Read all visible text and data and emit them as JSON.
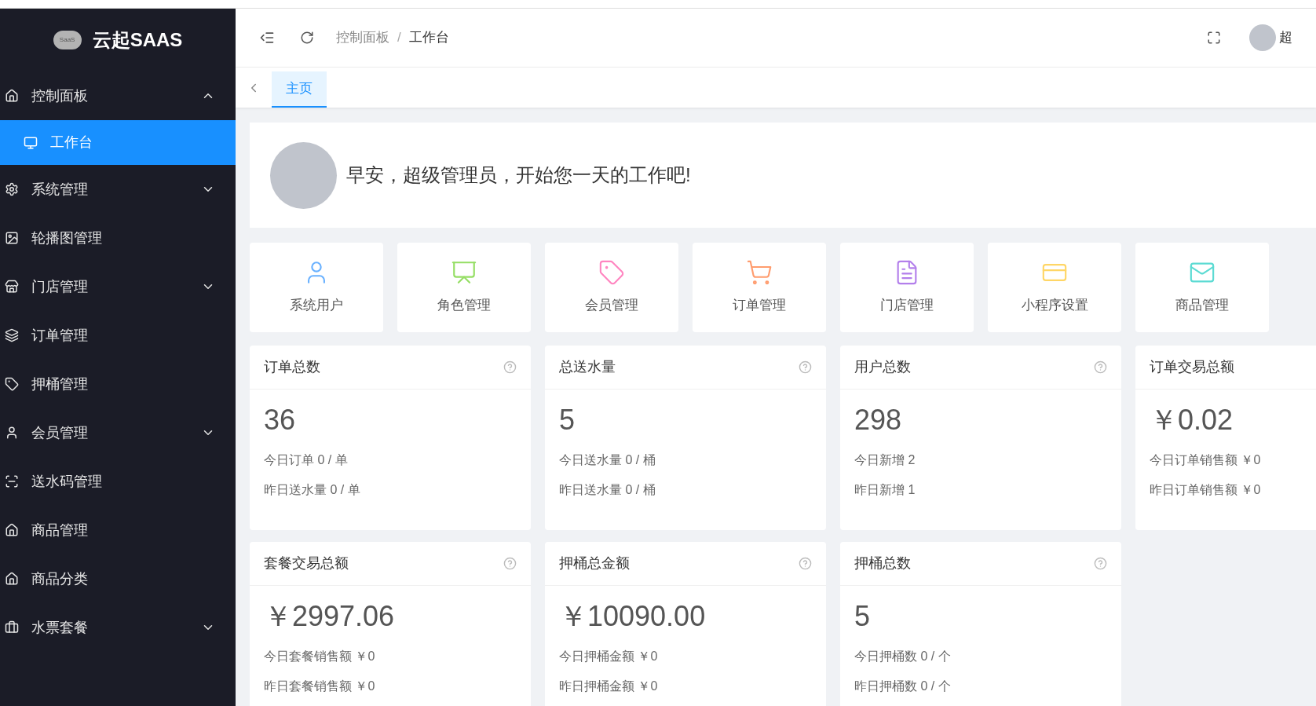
{
  "brand": {
    "logo_text": "SaaS",
    "name": "云起SAAS"
  },
  "sidebar": {
    "items": [
      {
        "label": "控制面板",
        "expanded": true,
        "has_children": true,
        "children": [
          {
            "label": "工作台",
            "selected": true
          }
        ]
      },
      {
        "label": "系统管理",
        "expanded": false,
        "has_children": true
      },
      {
        "label": "轮播图管理",
        "has_children": false
      },
      {
        "label": "门店管理",
        "expanded": false,
        "has_children": true
      },
      {
        "label": "订单管理",
        "has_children": false
      },
      {
        "label": "押桶管理",
        "has_children": false
      },
      {
        "label": "会员管理",
        "expanded": false,
        "has_children": true
      },
      {
        "label": "送水码管理",
        "has_children": false
      },
      {
        "label": "商品管理",
        "has_children": false
      },
      {
        "label": "商品分类",
        "has_children": false
      },
      {
        "label": "水票套餐",
        "expanded": false,
        "has_children": true
      }
    ]
  },
  "header": {
    "breadcrumb": [
      "控制面板",
      "工作台"
    ],
    "breadcrumb_separator": "/",
    "user_name": "超"
  },
  "tabs": [
    {
      "label": "主页",
      "selected": true
    }
  ],
  "greeting": "早安，超级管理员，开始您一天的工作吧!",
  "shortcuts": [
    {
      "label": "系统用户",
      "color": "#69b1ff"
    },
    {
      "label": "角色管理",
      "color": "#95de64"
    },
    {
      "label": "会员管理",
      "color": "#ff85c0"
    },
    {
      "label": "订单管理",
      "color": "#ff9c6e"
    },
    {
      "label": "门店管理",
      "color": "#b37feb"
    },
    {
      "label": "小程序设置",
      "color": "#ffd666"
    },
    {
      "label": "商品管理",
      "color": "#5cdbd3"
    }
  ],
  "stats": [
    {
      "title": "订单总数",
      "value": "36",
      "lines": [
        "今日订单 0 / 单",
        "昨日送水量 0 / 单"
      ],
      "help": true
    },
    {
      "title": "总送水量",
      "value": "5",
      "lines": [
        "今日送水量 0 / 桶",
        "昨日送水量 0 / 桶"
      ],
      "help": true
    },
    {
      "title": "用户总数",
      "value": "298",
      "lines": [
        "今日新增 2",
        "昨日新增 1"
      ],
      "help": true
    },
    {
      "title": "订单交易总额",
      "value": "￥0.02",
      "lines": [
        "今日订单销售额 ￥0",
        "昨日订单销售额 ￥0"
      ]
    },
    {
      "title": "套餐交易总额",
      "value": "￥2997.06",
      "lines": [
        "今日套餐销售额 ￥0",
        "昨日套餐销售额 ￥0"
      ],
      "help": true
    },
    {
      "title": "押桶总金额",
      "value": "￥10090.00",
      "lines": [
        "今日押桶金额 ￥0",
        "昨日押桶金额 ￥0"
      ],
      "help": true
    },
    {
      "title": "押桶总数",
      "value": "5",
      "lines": [
        "今日押桶数 0 / 个",
        "昨日押桶数 0 / 个"
      ],
      "help": true
    }
  ]
}
